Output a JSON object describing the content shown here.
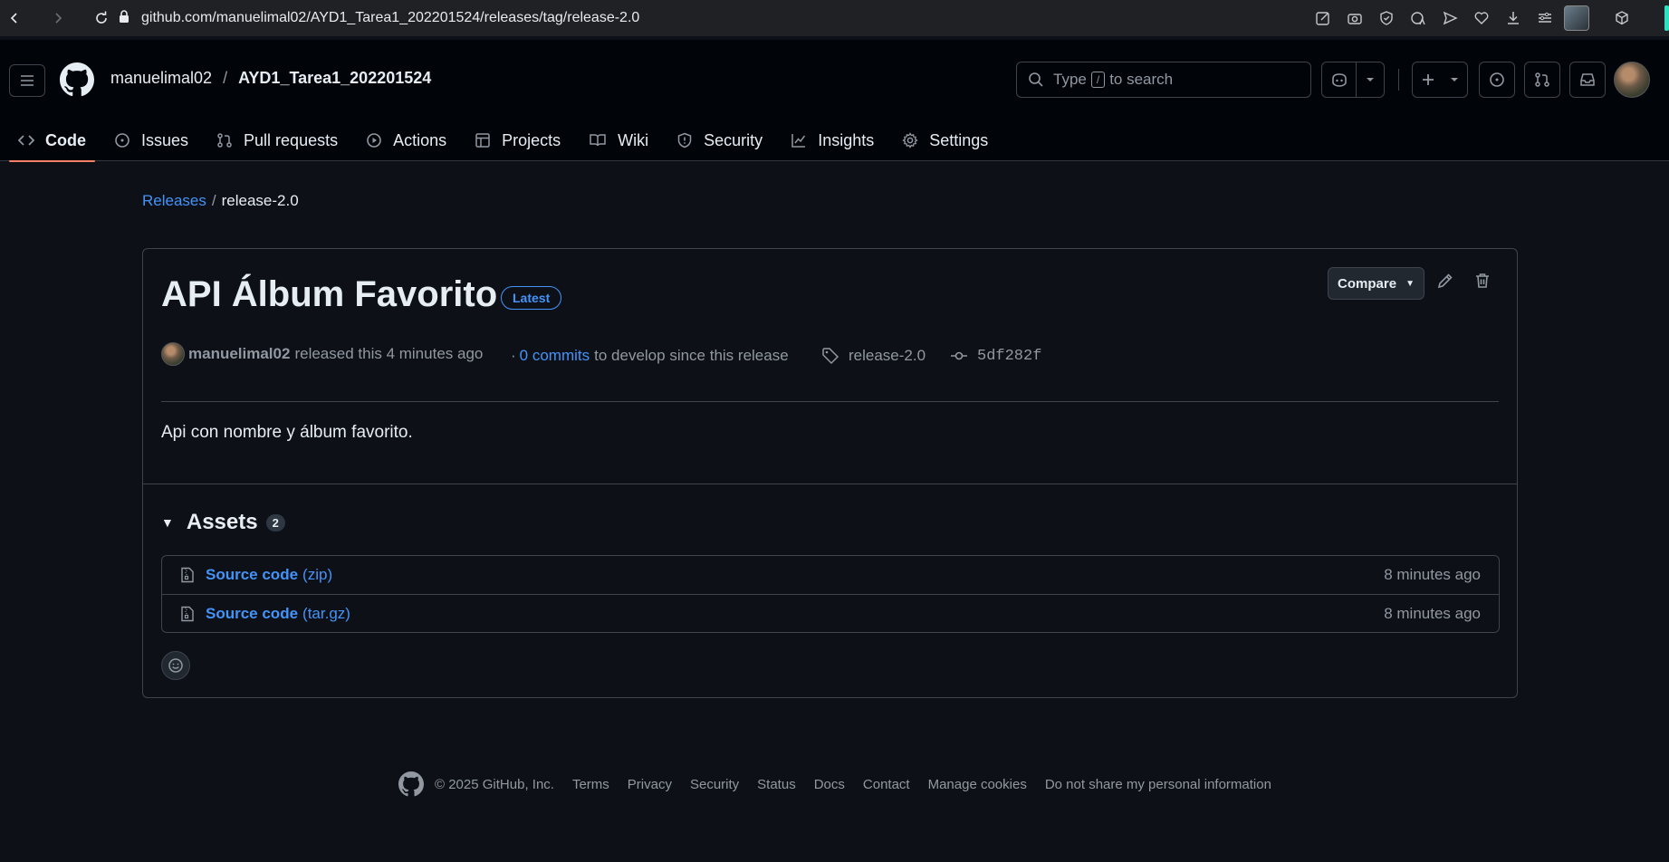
{
  "browser": {
    "url": "github.com/manuelimal02/AYD1_Tarea1_202201524/releases/tag/release-2.0"
  },
  "header": {
    "owner": "manuelimal02",
    "separator": "/",
    "repo": "AYD1_Tarea1_202201524",
    "search_before": "Type",
    "search_key": "/",
    "search_after": "to search"
  },
  "tabs": [
    {
      "label": "Code",
      "icon": "code-icon"
    },
    {
      "label": "Issues",
      "icon": "issue-icon"
    },
    {
      "label": "Pull requests",
      "icon": "pull-request-icon"
    },
    {
      "label": "Actions",
      "icon": "play-icon"
    },
    {
      "label": "Projects",
      "icon": "table-icon"
    },
    {
      "label": "Wiki",
      "icon": "book-icon"
    },
    {
      "label": "Security",
      "icon": "shield-icon"
    },
    {
      "label": "Insights",
      "icon": "graph-icon"
    },
    {
      "label": "Settings",
      "icon": "gear-icon"
    }
  ],
  "breadcrumb": {
    "releases": "Releases",
    "slash": "/",
    "current": "release-2.0"
  },
  "release": {
    "title": "API Álbum Favorito",
    "badge": "Latest",
    "compare_label": "Compare",
    "author": "manuelimal02",
    "released_text": "released this 4 minutes ago",
    "dot": "·",
    "commits_link": "0 commits",
    "commits_suffix": "to develop since this release",
    "tag": "release-2.0",
    "commit_sha": "5df282f",
    "description": "Api con nombre y álbum favorito."
  },
  "assets": {
    "heading": "Assets",
    "count": "2",
    "items": [
      {
        "name": "Source code",
        "ext": "(zip)",
        "time": "8 minutes ago"
      },
      {
        "name": "Source code",
        "ext": "(tar.gz)",
        "time": "8 minutes ago"
      }
    ]
  },
  "footer": {
    "copyright": "© 2025 GitHub, Inc.",
    "links": [
      "Terms",
      "Privacy",
      "Security",
      "Status",
      "Docs",
      "Contact",
      "Manage cookies",
      "Do not share my personal information"
    ]
  }
}
